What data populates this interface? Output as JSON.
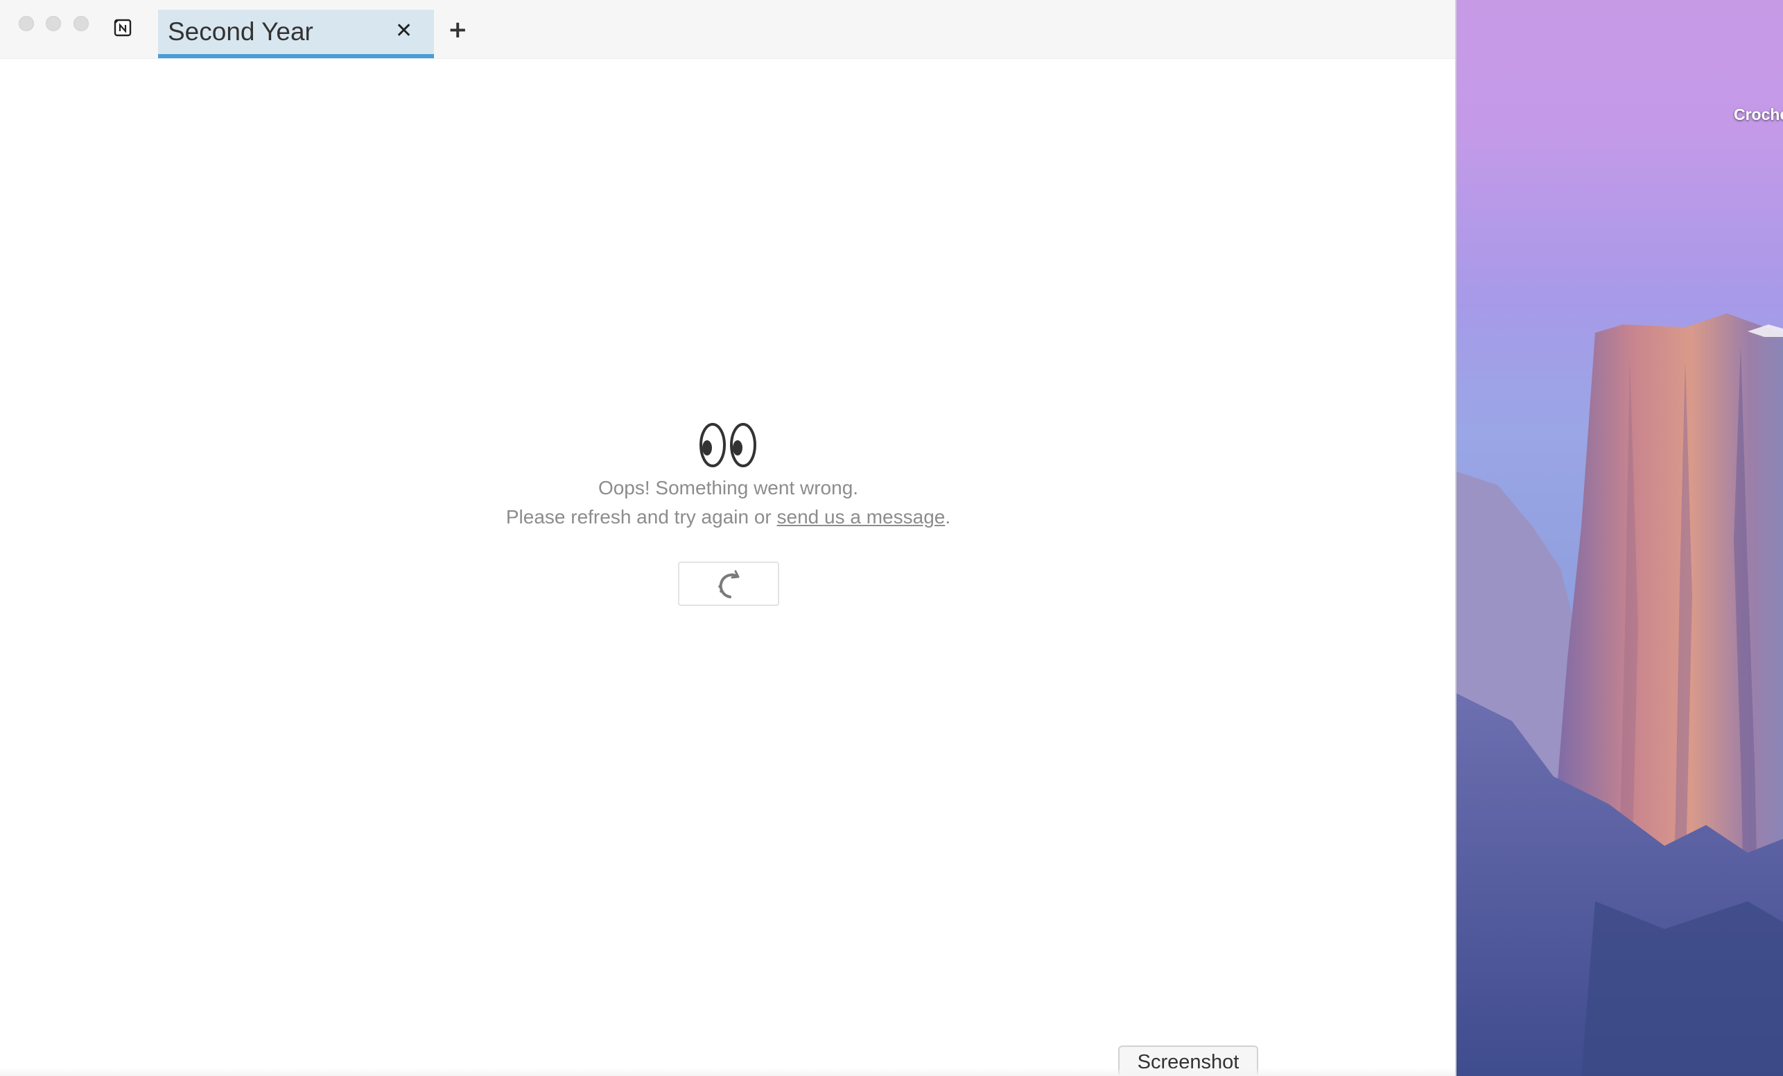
{
  "window": {
    "tabs": [
      {
        "label": "Second Year",
        "active": true
      }
    ],
    "close_tab_glyph": "✕",
    "add_tab_glyph": "+"
  },
  "error": {
    "icon": "eyes-icon",
    "line1": "Oops! Something went wrong.",
    "line2_prefix": "Please refresh and try again or ",
    "link_text": "send us a message",
    "line2_suffix": ".",
    "refresh_icon": "refresh-icon"
  },
  "screenshot_button": {
    "label": "Screenshot"
  },
  "desktop": {
    "icon_label": "Crochet Patter",
    "icon": "cat-icon"
  },
  "colors": {
    "tab_background": "#d8e6ef",
    "tab_underline": "#4a9cd6",
    "error_text": "#8c8c8c"
  }
}
